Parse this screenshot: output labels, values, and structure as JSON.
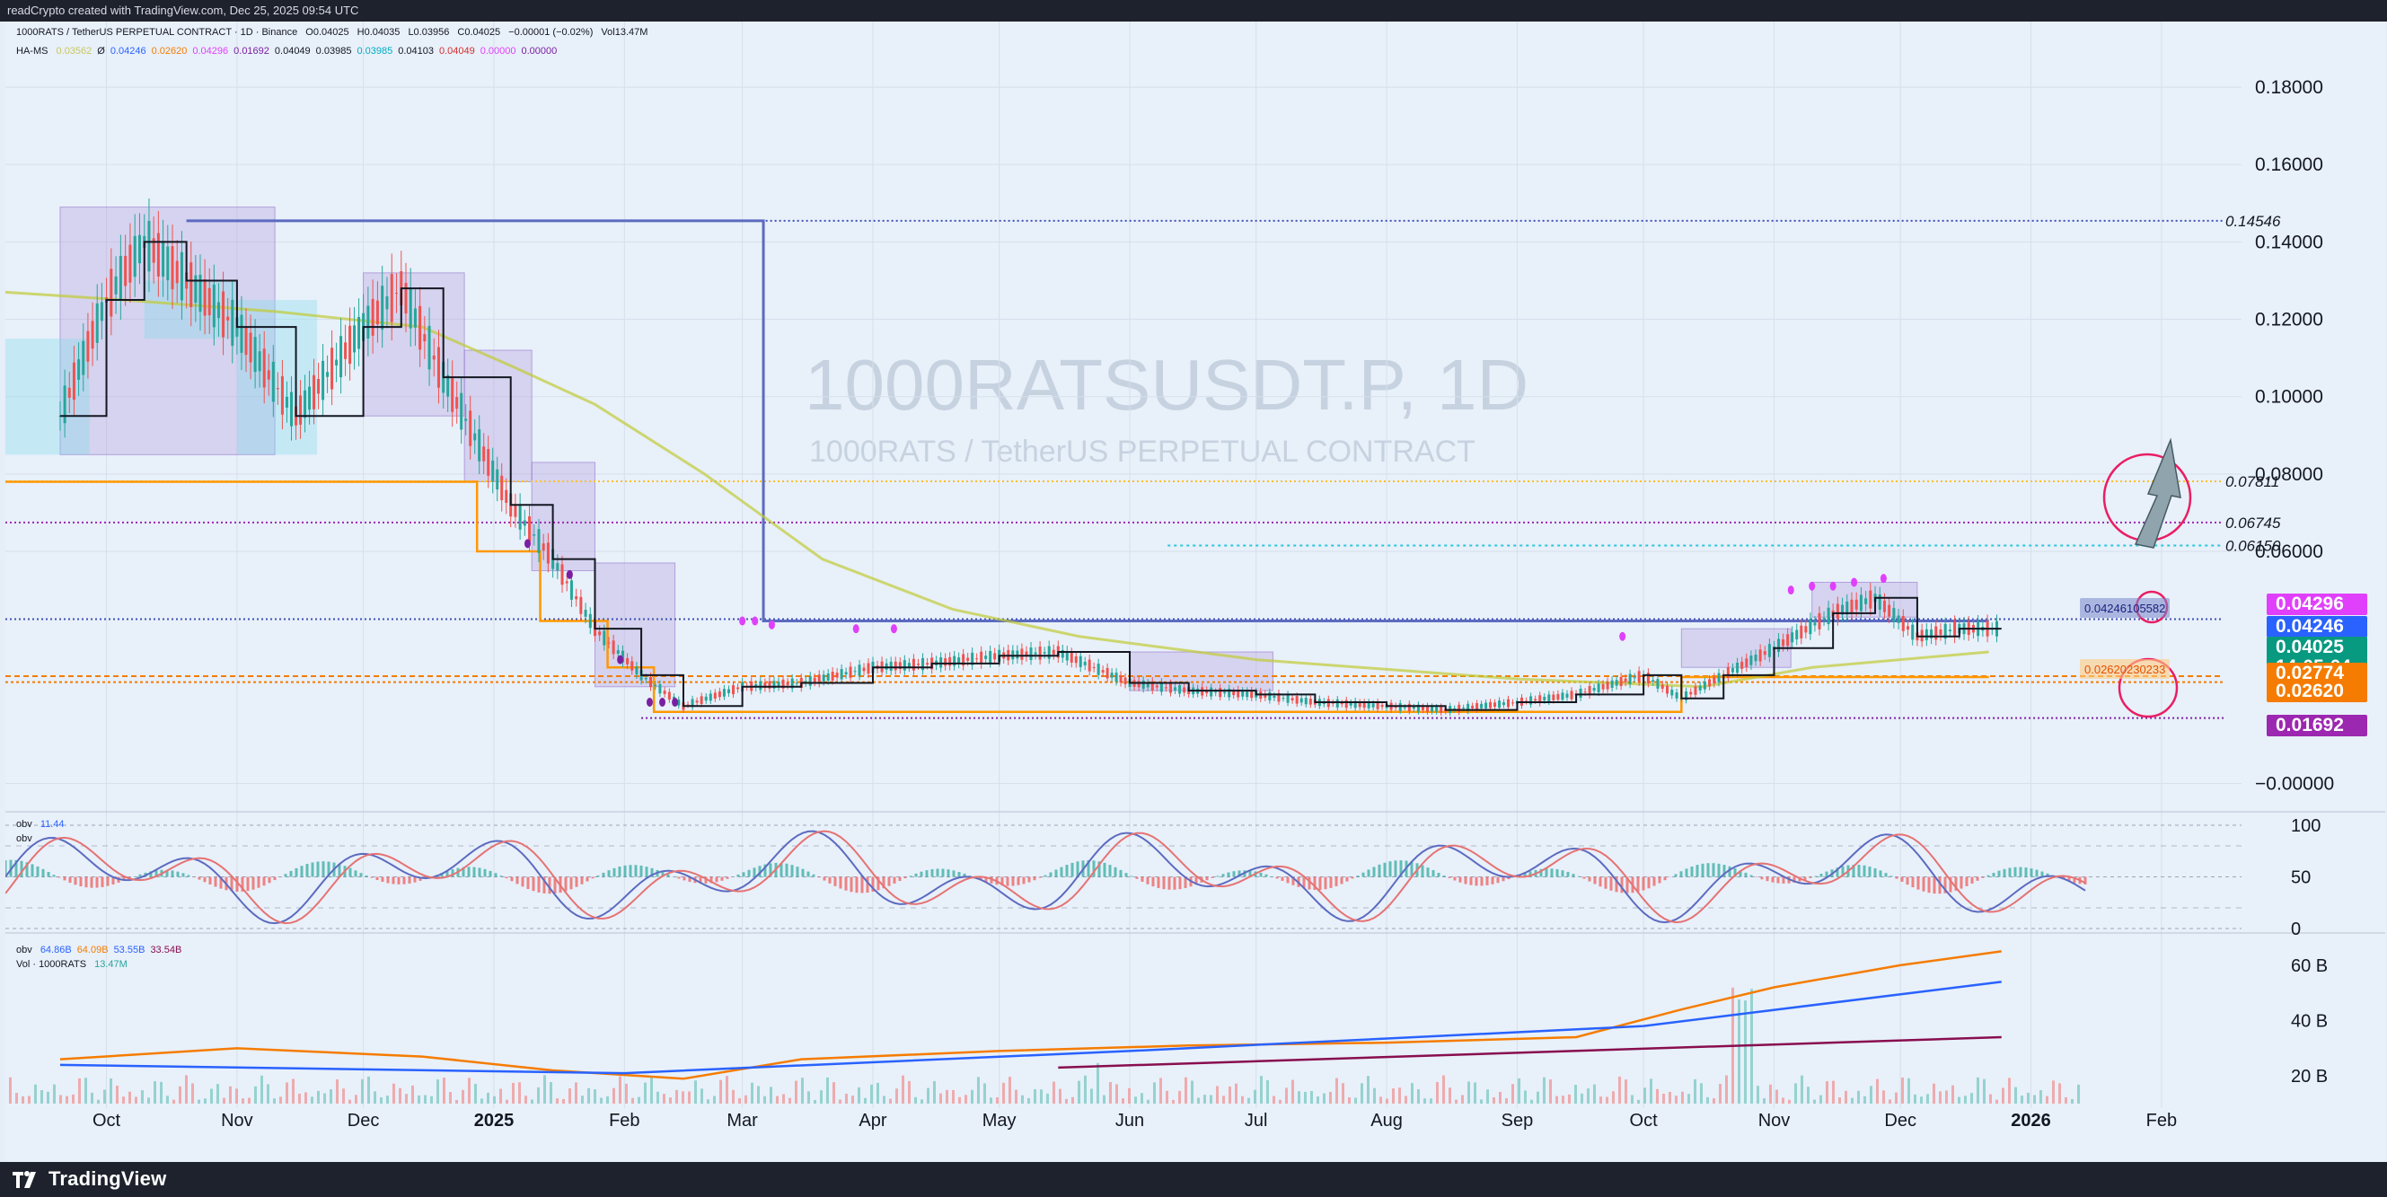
{
  "header": {
    "creator": "readCrypto created with TradingView.com, Dec 25, 2025 09:54 UTC"
  },
  "legend": {
    "symbol_line": "1000RATS / TetherUS PERPETUAL CONTRACT · 1D · Binance",
    "ohlc": {
      "o": "O0.04025",
      "h": "H0.04035",
      "l": "L0.03956",
      "c": "C0.04025",
      "chg": "−0.00001 (−0.02%)",
      "vol": "Vol13.47M"
    },
    "indicator_name": "HA-MS",
    "indicator_values": [
      {
        "v": "0.03562",
        "color": "#c9c85e"
      },
      {
        "v": "Ø",
        "color": "#131722"
      },
      {
        "v": "0.04246",
        "color": "#2962ff"
      },
      {
        "v": "0.02620",
        "color": "#f57c00"
      },
      {
        "v": "0.04296",
        "color": "#e040fb"
      },
      {
        "v": "0.01692",
        "color": "#7b1fa2"
      },
      {
        "v": "0.04049",
        "color": "#131722"
      },
      {
        "v": "0.03985",
        "color": "#131722"
      },
      {
        "v": "0.03985",
        "color": "#00acc1"
      },
      {
        "v": "0.04103",
        "color": "#131722"
      },
      {
        "v": "0.04049",
        "color": "#d32f2f"
      },
      {
        "v": "0.00000",
        "color": "#e040fb"
      },
      {
        "v": "0.00000",
        "color": "#7b1fa2"
      }
    ],
    "obv_pane": {
      "label1": "obv",
      "value1": "11.44",
      "label2": "obv"
    },
    "vol_pane": {
      "obv_label": "obv",
      "obv_values": [
        {
          "v": "64.86B",
          "color": "#2962ff"
        },
        {
          "v": "64.09B",
          "color": "#f57c00"
        },
        {
          "v": "53.55B",
          "color": "#2962ff"
        },
        {
          "v": "33.54B",
          "color": "#880e4f"
        }
      ],
      "vol_label": "Vol · 1000RATS",
      "vol_value": "13.47M"
    }
  },
  "watermark": {
    "title": "1000RATSUSDT.P, 1D",
    "subtitle": "1000RATS / TetherUS PERPETUAL CONTRACT"
  },
  "levels": {
    "l1": "0.14546",
    "l2": "0.07811",
    "l3": "0.06745",
    "l4": "0.06150",
    "box1": "0.04246105582",
    "box2": "0.02620230233"
  },
  "price_tags": [
    {
      "label": "0.04296",
      "color": "#e040fb"
    },
    {
      "label": "0.04246",
      "color": "#2962ff"
    },
    {
      "label": "0.04025",
      "color": "#089981"
    },
    {
      "label": "14:05:04",
      "color": "#089981"
    },
    {
      "label": "0.02774",
      "color": "#f57c00"
    },
    {
      "label": "0.02620",
      "color": "#f57c00"
    },
    {
      "label": "0.01692",
      "color": "#9c27b0"
    }
  ],
  "brand": {
    "name": "TradingView"
  },
  "chart_data": [
    {
      "type": "candlestick",
      "title": "1000RATSUSDT.P, 1D",
      "x_ticks": [
        "Oct",
        "Nov",
        "Dec",
        "2025",
        "Feb",
        "Mar",
        "Apr",
        "May",
        "Jun",
        "Jul",
        "Aug",
        "Sep",
        "Oct",
        "Nov",
        "Dec",
        "2026",
        "Feb"
      ],
      "y_ticks": [
        "0.18000",
        "0.16000",
        "0.14000",
        "0.12000",
        "0.10000",
        "0.08000",
        "0.06000",
        "−0.00000"
      ],
      "ylim": [
        -0.005,
        0.19
      ],
      "grid": true,
      "series": [
        {
          "name": "price close (approx)",
          "x": [
            "2024-09-20",
            "2024-10-01",
            "2024-10-10",
            "2024-10-20",
            "2024-11-01",
            "2024-11-15",
            "2024-12-01",
            "2024-12-10",
            "2024-12-20",
            "2025-01-05",
            "2025-01-15",
            "2025-01-25",
            "2025-02-05",
            "2025-02-15",
            "2025-03-01",
            "2025-03-15",
            "2025-04-01",
            "2025-04-15",
            "2025-05-01",
            "2025-05-15",
            "2025-06-01",
            "2025-06-15",
            "2025-07-01",
            "2025-07-15",
            "2025-08-01",
            "2025-08-15",
            "2025-09-01",
            "2025-09-15",
            "2025-10-01",
            "2025-10-10",
            "2025-10-20",
            "2025-11-01",
            "2025-11-15",
            "2025-11-25",
            "2025-12-05",
            "2025-12-15",
            "2025-12-25"
          ],
          "values": [
            0.095,
            0.125,
            0.14,
            0.13,
            0.118,
            0.095,
            0.118,
            0.128,
            0.105,
            0.072,
            0.058,
            0.04,
            0.028,
            0.02,
            0.025,
            0.026,
            0.03,
            0.031,
            0.033,
            0.034,
            0.026,
            0.024,
            0.023,
            0.021,
            0.02,
            0.019,
            0.021,
            0.023,
            0.028,
            0.022,
            0.028,
            0.035,
            0.044,
            0.048,
            0.038,
            0.04,
            0.04
          ]
        }
      ],
      "horizontal_levels": [
        0.14546,
        0.07811,
        0.06745,
        0.0615,
        0.04296,
        0.04246,
        0.02774,
        0.0262,
        0.01692
      ]
    },
    {
      "type": "line",
      "title": "obv",
      "y_ticks": [
        "100",
        "50",
        "0"
      ],
      "ylim": [
        0,
        100
      ]
    },
    {
      "type": "line",
      "title": "obv / Vol",
      "y_ticks": [
        "60 B",
        "40 B",
        "20 B"
      ],
      "ylim": [
        10,
        70
      ],
      "series": [
        {
          "name": "obv",
          "x": [
            "2024-09-20",
            "2024-11-01",
            "2024-12-15",
            "2025-01-15",
            "2025-02-15",
            "2025-03-15",
            "2025-05-01",
            "2025-06-15",
            "2025-08-01",
            "2025-09-15",
            "2025-10-10",
            "2025-11-01",
            "2025-12-01",
            "2025-12-25"
          ],
          "values": [
            26,
            30,
            27,
            22,
            19,
            26,
            29,
            31,
            32,
            34,
            44,
            52,
            60,
            65
          ]
        },
        {
          "name": "ma slow",
          "x": [
            "2024-09-20",
            "2025-02-01",
            "2025-06-01",
            "2025-10-01",
            "2025-12-25"
          ],
          "values": [
            24,
            21,
            29,
            38,
            54
          ]
        },
        {
          "name": "ma long",
          "x": [
            "2025-05-15",
            "2025-12-25"
          ],
          "values": [
            23,
            34
          ]
        }
      ]
    }
  ]
}
